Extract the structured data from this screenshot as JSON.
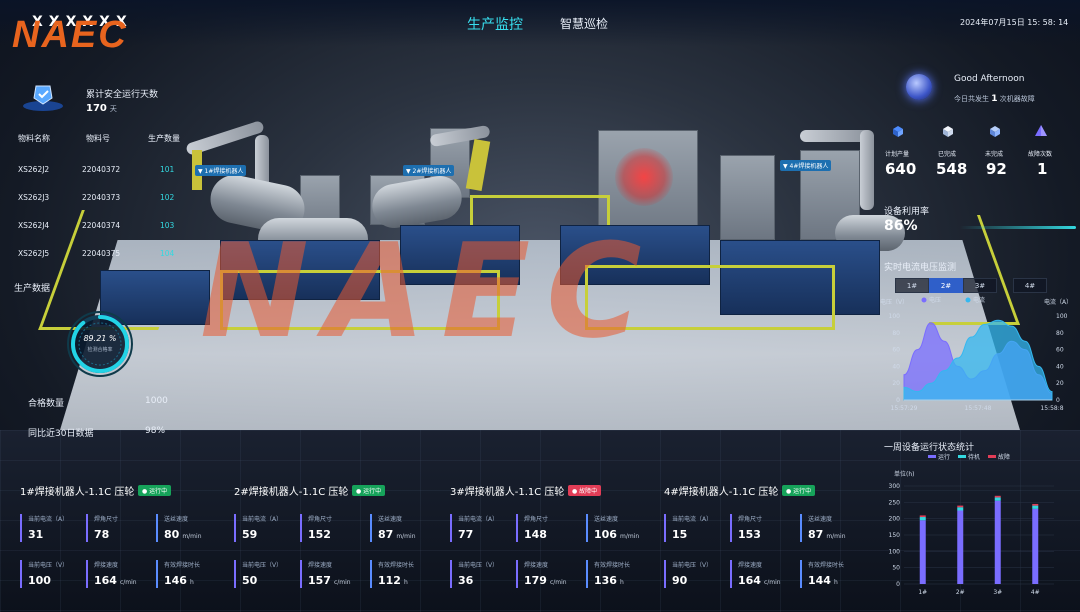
{
  "header": {
    "logo_text": "NAEC",
    "logo_overlay": "XXXXXX",
    "nav_active": "生产监控",
    "nav_tab": "智慧巡检",
    "datetime": "2024年07月15日 15: 58: 14"
  },
  "watermark_text": "NAEC",
  "left": {
    "safe_title": "累计安全运行天数",
    "safe_value": "170",
    "safe_unit": "天",
    "table_headers": [
      "物料名称",
      "物料号",
      "生产数量"
    ],
    "table_rows": [
      {
        "name": "XS262J2",
        "code": "22040372",
        "qty": "101"
      },
      {
        "name": "XS262J3",
        "code": "22040373",
        "qty": "102"
      },
      {
        "name": "XS262J4",
        "code": "22040374",
        "qty": "103"
      },
      {
        "name": "XS262J5",
        "code": "22040375",
        "qty": "104"
      }
    ],
    "section_title": "生产数据",
    "gauge_value": "89.21 %",
    "gauge_fraction": 0.8921,
    "gauge_sub": "检测合格率",
    "stats": [
      {
        "label": "合格数量",
        "value": "1000"
      },
      {
        "label": "同比近30日数据",
        "value": "98%"
      }
    ]
  },
  "right": {
    "greeting": "Good Afternoon",
    "greeting_sub_prefix": "今日共发生",
    "greeting_sub_num": "1",
    "greeting_sub_suffix": "次机器故障",
    "kpis": [
      {
        "label": "计划产量",
        "value": "640",
        "icon": "box-icon",
        "color": "#4d8cff"
      },
      {
        "label": "已完成",
        "value": "548",
        "icon": "cube-icon",
        "color": "#e8eef8"
      },
      {
        "label": "未完成",
        "value": "92",
        "icon": "cube-icon",
        "color": "#8fb5ff"
      },
      {
        "label": "故障次数",
        "value": "1",
        "icon": "warning-icon",
        "color": "#7a6dff"
      }
    ],
    "util_title": "设备利用率",
    "util_value": "86%",
    "util_fraction": 0.86,
    "volt_title": "实时电流电压监测",
    "tabs": [
      "1#",
      "2#",
      "3#",
      "4#"
    ],
    "active_tab": "2#"
  },
  "chart_data": [
    {
      "type": "area",
      "title": "实时电流电压监测",
      "ylabel_left": "电压（V）",
      "ylabel_right": "电流（A）",
      "ylim": [
        0,
        100
      ],
      "yticks": [
        "0",
        "20",
        "40",
        "60",
        "80",
        "100"
      ],
      "x": [
        "15:57:29",
        "15:57:48",
        "15:58:8"
      ],
      "legend_position": "top",
      "series": [
        {
          "name": "电压",
          "color": "#7a6dff",
          "values": [
            30,
            60,
            92,
            70,
            40,
            25,
            35,
            55,
            70,
            60,
            30,
            8
          ]
        },
        {
          "name": "电流",
          "color": "#34b8f0",
          "values": [
            15,
            10,
            20,
            35,
            50,
            75,
            90,
            95,
            88,
            70,
            40,
            10
          ]
        }
      ]
    },
    {
      "type": "bar",
      "title": "一周设备运行状态统计",
      "ylabel": "单位(h)",
      "ylim": [
        0,
        300
      ],
      "yticks": [
        "0",
        "50",
        "100",
        "150",
        "200",
        "250",
        "300"
      ],
      "categories": [
        "1#",
        "2#",
        "3#",
        "4#"
      ],
      "legend_position": "top",
      "series": [
        {
          "name": "运行",
          "color": "#7a6dff",
          "values": [
            195,
            225,
            255,
            230
          ]
        },
        {
          "name": "待机",
          "color": "#34d8e0",
          "values": [
            10,
            10,
            10,
            10
          ]
        },
        {
          "name": "故障",
          "color": "#e23d57",
          "values": [
            5,
            5,
            5,
            5
          ]
        }
      ]
    }
  ],
  "robots": [
    {
      "title": "1#焊接机器人-1.1C 压轮",
      "status": "运行中",
      "status_type": "run",
      "metrics": [
        {
          "label": "当前电流（A）",
          "value": "31",
          "unit": ""
        },
        {
          "label": "焊角尺寸",
          "value": "78",
          "unit": ""
        },
        {
          "label": "送丝速度",
          "value": "80",
          "unit": "m/min"
        },
        {
          "label": "当前电压（V）",
          "value": "100",
          "unit": ""
        },
        {
          "label": "焊接速度",
          "value": "164",
          "unit": "c/min"
        },
        {
          "label": "有效焊接时长",
          "value": "146",
          "unit": "h"
        }
      ]
    },
    {
      "title": "2#焊接机器人-1.1C 压轮",
      "status": "运行中",
      "status_type": "run",
      "metrics": [
        {
          "label": "当前电流（A）",
          "value": "59",
          "unit": ""
        },
        {
          "label": "焊角尺寸",
          "value": "152",
          "unit": ""
        },
        {
          "label": "送丝速度",
          "value": "87",
          "unit": "m/min"
        },
        {
          "label": "当前电压（V）",
          "value": "50",
          "unit": ""
        },
        {
          "label": "焊接速度",
          "value": "157",
          "unit": "c/min"
        },
        {
          "label": "有效焊接时长",
          "value": "112",
          "unit": "h"
        }
      ]
    },
    {
      "title": "3#焊接机器人-1.1C 压轮",
      "status": "故障中",
      "status_type": "fault",
      "metrics": [
        {
          "label": "当前电流（A）",
          "value": "77",
          "unit": ""
        },
        {
          "label": "焊角尺寸",
          "value": "148",
          "unit": ""
        },
        {
          "label": "送丝速度",
          "value": "106",
          "unit": "m/min"
        },
        {
          "label": "当前电压（V）",
          "value": "36",
          "unit": ""
        },
        {
          "label": "焊接速度",
          "value": "179",
          "unit": "c/min"
        },
        {
          "label": "有效焊接时长",
          "value": "136",
          "unit": "h"
        }
      ]
    },
    {
      "title": "4#焊接机器人-1.1C 压轮",
      "status": "运行中",
      "status_type": "run",
      "metrics": [
        {
          "label": "当前电流（A）",
          "value": "15",
          "unit": ""
        },
        {
          "label": "焊角尺寸",
          "value": "153",
          "unit": ""
        },
        {
          "label": "送丝速度",
          "value": "87",
          "unit": "m/min"
        },
        {
          "label": "当前电压（V）",
          "value": "90",
          "unit": ""
        },
        {
          "label": "焊接速度",
          "value": "164",
          "unit": "c/min"
        },
        {
          "label": "有效焊接时长",
          "value": "144",
          "unit": "h"
        }
      ]
    }
  ]
}
